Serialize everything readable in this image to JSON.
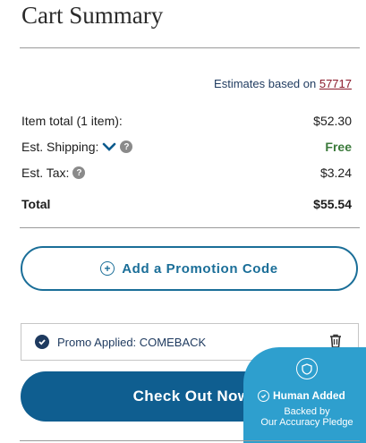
{
  "header": {
    "title": "Cart Summary"
  },
  "estimates": {
    "prefix": "Estimates based on ",
    "zip": "57717"
  },
  "rows": {
    "item_total_label": "Item total (1 item):",
    "item_total_value": "$52.30",
    "shipping_label": "Est. Shipping:",
    "shipping_value": "Free",
    "tax_label": "Est. Tax:",
    "tax_value": "$3.24",
    "total_label": "Total",
    "total_value": "$55.54"
  },
  "promo_button": {
    "label": "Add a Promotion Code"
  },
  "promo_applied": {
    "text": "Promo Applied: COMEBACK"
  },
  "checkout": {
    "label": "Check Out Now"
  },
  "badge": {
    "headline": "Human Added",
    "line1": "Backed by",
    "line2": "Our Accuracy Pledge"
  },
  "colors": {
    "accent": "#0f5e90",
    "outline": "#1a6e98",
    "free": "#3b7a3b",
    "badge": "#2e9fce",
    "zip": "#8b1a2b"
  },
  "icons": {
    "shipping_toggle": "chevron-down-icon",
    "help": "question-icon",
    "add": "plus-circle-icon",
    "applied": "check-circle-icon",
    "remove": "trash-icon",
    "badge": "shield-icon"
  }
}
